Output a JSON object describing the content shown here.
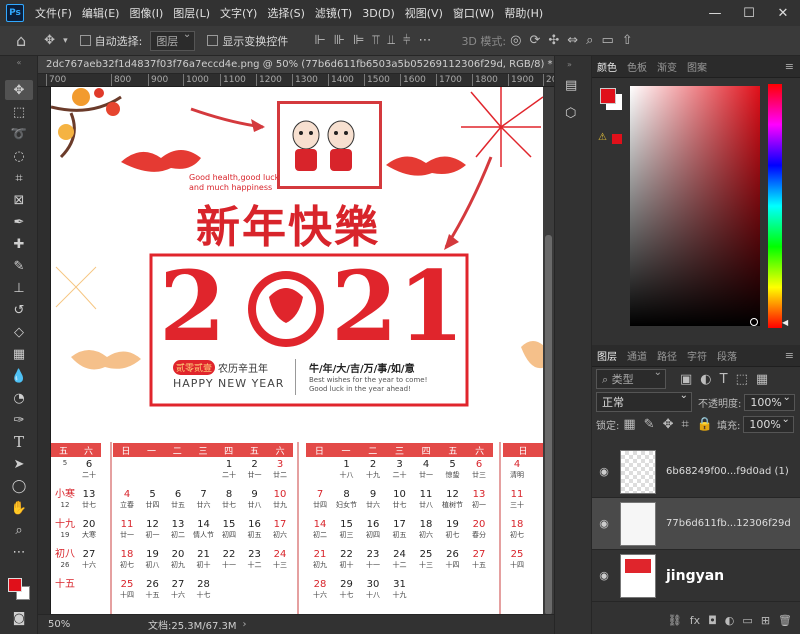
{
  "menubar": {
    "logo": "Ps",
    "items": [
      "文件(F)",
      "编辑(E)",
      "图像(I)",
      "图层(L)",
      "文字(Y)",
      "选择(S)",
      "滤镜(T)",
      "3D(D)",
      "视图(V)",
      "窗口(W)",
      "帮助(H)"
    ],
    "win_min": "—",
    "win_max": "☐",
    "win_close": "✕"
  },
  "options": {
    "auto_select": "自动选择:",
    "layer_select": "图层",
    "show_transform": "显示变换控件",
    "mode_3d": "3D 模式:"
  },
  "document": {
    "tab_title": "2dc767aeb32f1d4837f03f76a7eccd4e.png @ 50% (77b6d611fb6503a5b05269112306f29d, RGB/8) *",
    "tab_close": "×",
    "ruler": [
      "700",
      "800",
      "900",
      "1000",
      "1100",
      "1200",
      "1300",
      "1400",
      "1500",
      "1600",
      "1700",
      "1800",
      "1900",
      "2000"
    ],
    "zoom": "50%",
    "doc_size": "文档:25.3M/67.3M"
  },
  "artwork": {
    "eng_line1": "Good health,good luck",
    "eng_line2": "and much happiness",
    "title": "新年快樂",
    "year_left": "2",
    "year_right": "21",
    "gold_badge": "贰零贰壹",
    "lunar": "农历辛丑年",
    "happy": "HAPPY NEW YEAR",
    "wishes": "牛/年/大/吉/万/事/如/意",
    "wish_en1": "Best wishes for the year to come!",
    "wish_en2": "Good luck in the year ahead!",
    "cal1_head": [
      "五",
      "六"
    ],
    "cal2_head": [
      "日",
      "一",
      "二",
      "三",
      "四",
      "五",
      "六"
    ],
    "cal3_head": [
      "日",
      "一",
      "二",
      "三",
      "四",
      "五",
      "六"
    ],
    "cal4_head": [
      "日"
    ],
    "cal1": [
      [
        "",
        "5",
        "小寒",
        "12",
        "十九",
        "19",
        "初八",
        "26",
        "十五"
      ],
      [
        "6",
        "二十",
        "13",
        "廿七",
        "20",
        "大寒",
        "27",
        "十六"
      ]
    ],
    "cal2": [
      [
        "",
        "",
        "4",
        "立春",
        "11",
        "廿一",
        "18",
        "初七",
        "25",
        "十四"
      ],
      [
        "",
        "",
        "5",
        "廿四",
        "12",
        "初一",
        "19",
        "初八",
        "26",
        "十五"
      ],
      [
        "",
        "",
        "6",
        "廿五",
        "13",
        "初二",
        "20",
        "初九",
        "27",
        "十六"
      ],
      [
        "",
        "",
        "7",
        "廿六",
        "14",
        "情人节",
        "21",
        "初十",
        "28",
        "十七"
      ],
      [
        "1",
        "二十",
        "8",
        "廿七",
        "15",
        "初四",
        "22",
        "十一",
        "",
        ""
      ],
      [
        "2",
        "廿一",
        "9",
        "廿八",
        "16",
        "初五",
        "23",
        "十二",
        "",
        ""
      ],
      [
        "3",
        "廿二",
        "10",
        "廿九",
        "17",
        "初六",
        "24",
        "十三",
        "",
        ""
      ]
    ],
    "cal3": [
      [
        "",
        "",
        "7",
        "廿四",
        "14",
        "初二",
        "21",
        "初九",
        "28",
        "十六"
      ],
      [
        "1",
        "十八",
        "8",
        "妇女节",
        "15",
        "初三",
        "22",
        "初十",
        "29",
        "十七"
      ],
      [
        "2",
        "十九",
        "9",
        "廿六",
        "16",
        "初四",
        "23",
        "十一",
        "30",
        "十八"
      ],
      [
        "3",
        "二十",
        "10",
        "廿七",
        "17",
        "初五",
        "24",
        "十二",
        "31",
        "十九"
      ],
      [
        "4",
        "廿一",
        "11",
        "廿八",
        "18",
        "初六",
        "25",
        "十三",
        "",
        ""
      ],
      [
        "5",
        "惊蛰",
        "12",
        "植树节",
        "19",
        "初七",
        "26",
        "十四",
        "",
        ""
      ],
      [
        "6",
        "廿三",
        "13",
        "初一",
        "20",
        "春分",
        "27",
        "十五",
        "",
        ""
      ]
    ],
    "cal4": [
      [
        "4",
        "清明",
        "11",
        "三十",
        "18",
        "初七",
        "25",
        "十四"
      ]
    ]
  },
  "panels": {
    "color_tabs": [
      "颜色",
      "色板",
      "渐变",
      "图案"
    ],
    "layer_tabs": [
      "图层",
      "通道",
      "路径",
      "字符",
      "段落"
    ],
    "kind": "类型",
    "blend": "正常",
    "opacity_label": "不透明度:",
    "opacity": "100%",
    "lock_label": "锁定:",
    "fill_label": "填充:",
    "fill": "100%",
    "layers": [
      {
        "name": "6b68249f00...f9d0ad (1)"
      },
      {
        "name": "77b6d611fb...12306f29d"
      }
    ],
    "watermark": "jingyan"
  },
  "colors": {
    "foreground": "#e0101a",
    "background": "#ffffff",
    "accent": "#31a8ff",
    "red": "#d8242b"
  }
}
